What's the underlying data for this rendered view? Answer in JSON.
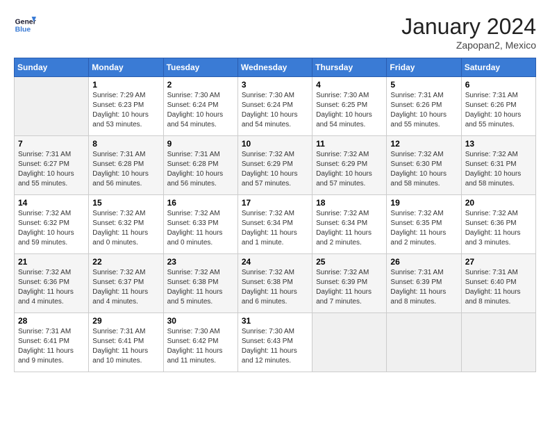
{
  "header": {
    "logo_text_general": "General",
    "logo_text_blue": "Blue",
    "title": "January 2024",
    "subtitle": "Zapopan2, Mexico"
  },
  "weekdays": [
    "Sunday",
    "Monday",
    "Tuesday",
    "Wednesday",
    "Thursday",
    "Friday",
    "Saturday"
  ],
  "weeks": [
    [
      {
        "day": "",
        "info": ""
      },
      {
        "day": "1",
        "info": "Sunrise: 7:29 AM\nSunset: 6:23 PM\nDaylight: 10 hours\nand 53 minutes."
      },
      {
        "day": "2",
        "info": "Sunrise: 7:30 AM\nSunset: 6:24 PM\nDaylight: 10 hours\nand 54 minutes."
      },
      {
        "day": "3",
        "info": "Sunrise: 7:30 AM\nSunset: 6:24 PM\nDaylight: 10 hours\nand 54 minutes."
      },
      {
        "day": "4",
        "info": "Sunrise: 7:30 AM\nSunset: 6:25 PM\nDaylight: 10 hours\nand 54 minutes."
      },
      {
        "day": "5",
        "info": "Sunrise: 7:31 AM\nSunset: 6:26 PM\nDaylight: 10 hours\nand 55 minutes."
      },
      {
        "day": "6",
        "info": "Sunrise: 7:31 AM\nSunset: 6:26 PM\nDaylight: 10 hours\nand 55 minutes."
      }
    ],
    [
      {
        "day": "7",
        "info": "Sunrise: 7:31 AM\nSunset: 6:27 PM\nDaylight: 10 hours\nand 55 minutes."
      },
      {
        "day": "8",
        "info": "Sunrise: 7:31 AM\nSunset: 6:28 PM\nDaylight: 10 hours\nand 56 minutes."
      },
      {
        "day": "9",
        "info": "Sunrise: 7:31 AM\nSunset: 6:28 PM\nDaylight: 10 hours\nand 56 minutes."
      },
      {
        "day": "10",
        "info": "Sunrise: 7:32 AM\nSunset: 6:29 PM\nDaylight: 10 hours\nand 57 minutes."
      },
      {
        "day": "11",
        "info": "Sunrise: 7:32 AM\nSunset: 6:29 PM\nDaylight: 10 hours\nand 57 minutes."
      },
      {
        "day": "12",
        "info": "Sunrise: 7:32 AM\nSunset: 6:30 PM\nDaylight: 10 hours\nand 58 minutes."
      },
      {
        "day": "13",
        "info": "Sunrise: 7:32 AM\nSunset: 6:31 PM\nDaylight: 10 hours\nand 58 minutes."
      }
    ],
    [
      {
        "day": "14",
        "info": "Sunrise: 7:32 AM\nSunset: 6:32 PM\nDaylight: 10 hours\nand 59 minutes."
      },
      {
        "day": "15",
        "info": "Sunrise: 7:32 AM\nSunset: 6:32 PM\nDaylight: 11 hours\nand 0 minutes."
      },
      {
        "day": "16",
        "info": "Sunrise: 7:32 AM\nSunset: 6:33 PM\nDaylight: 11 hours\nand 0 minutes."
      },
      {
        "day": "17",
        "info": "Sunrise: 7:32 AM\nSunset: 6:34 PM\nDaylight: 11 hours\nand 1 minute."
      },
      {
        "day": "18",
        "info": "Sunrise: 7:32 AM\nSunset: 6:34 PM\nDaylight: 11 hours\nand 2 minutes."
      },
      {
        "day": "19",
        "info": "Sunrise: 7:32 AM\nSunset: 6:35 PM\nDaylight: 11 hours\nand 2 minutes."
      },
      {
        "day": "20",
        "info": "Sunrise: 7:32 AM\nSunset: 6:36 PM\nDaylight: 11 hours\nand 3 minutes."
      }
    ],
    [
      {
        "day": "21",
        "info": "Sunrise: 7:32 AM\nSunset: 6:36 PM\nDaylight: 11 hours\nand 4 minutes."
      },
      {
        "day": "22",
        "info": "Sunrise: 7:32 AM\nSunset: 6:37 PM\nDaylight: 11 hours\nand 4 minutes."
      },
      {
        "day": "23",
        "info": "Sunrise: 7:32 AM\nSunset: 6:38 PM\nDaylight: 11 hours\nand 5 minutes."
      },
      {
        "day": "24",
        "info": "Sunrise: 7:32 AM\nSunset: 6:38 PM\nDaylight: 11 hours\nand 6 minutes."
      },
      {
        "day": "25",
        "info": "Sunrise: 7:32 AM\nSunset: 6:39 PM\nDaylight: 11 hours\nand 7 minutes."
      },
      {
        "day": "26",
        "info": "Sunrise: 7:31 AM\nSunset: 6:39 PM\nDaylight: 11 hours\nand 8 minutes."
      },
      {
        "day": "27",
        "info": "Sunrise: 7:31 AM\nSunset: 6:40 PM\nDaylight: 11 hours\nand 8 minutes."
      }
    ],
    [
      {
        "day": "28",
        "info": "Sunrise: 7:31 AM\nSunset: 6:41 PM\nDaylight: 11 hours\nand 9 minutes."
      },
      {
        "day": "29",
        "info": "Sunrise: 7:31 AM\nSunset: 6:41 PM\nDaylight: 11 hours\nand 10 minutes."
      },
      {
        "day": "30",
        "info": "Sunrise: 7:30 AM\nSunset: 6:42 PM\nDaylight: 11 hours\nand 11 minutes."
      },
      {
        "day": "31",
        "info": "Sunrise: 7:30 AM\nSunset: 6:43 PM\nDaylight: 11 hours\nand 12 minutes."
      },
      {
        "day": "",
        "info": ""
      },
      {
        "day": "",
        "info": ""
      },
      {
        "day": "",
        "info": ""
      }
    ]
  ]
}
